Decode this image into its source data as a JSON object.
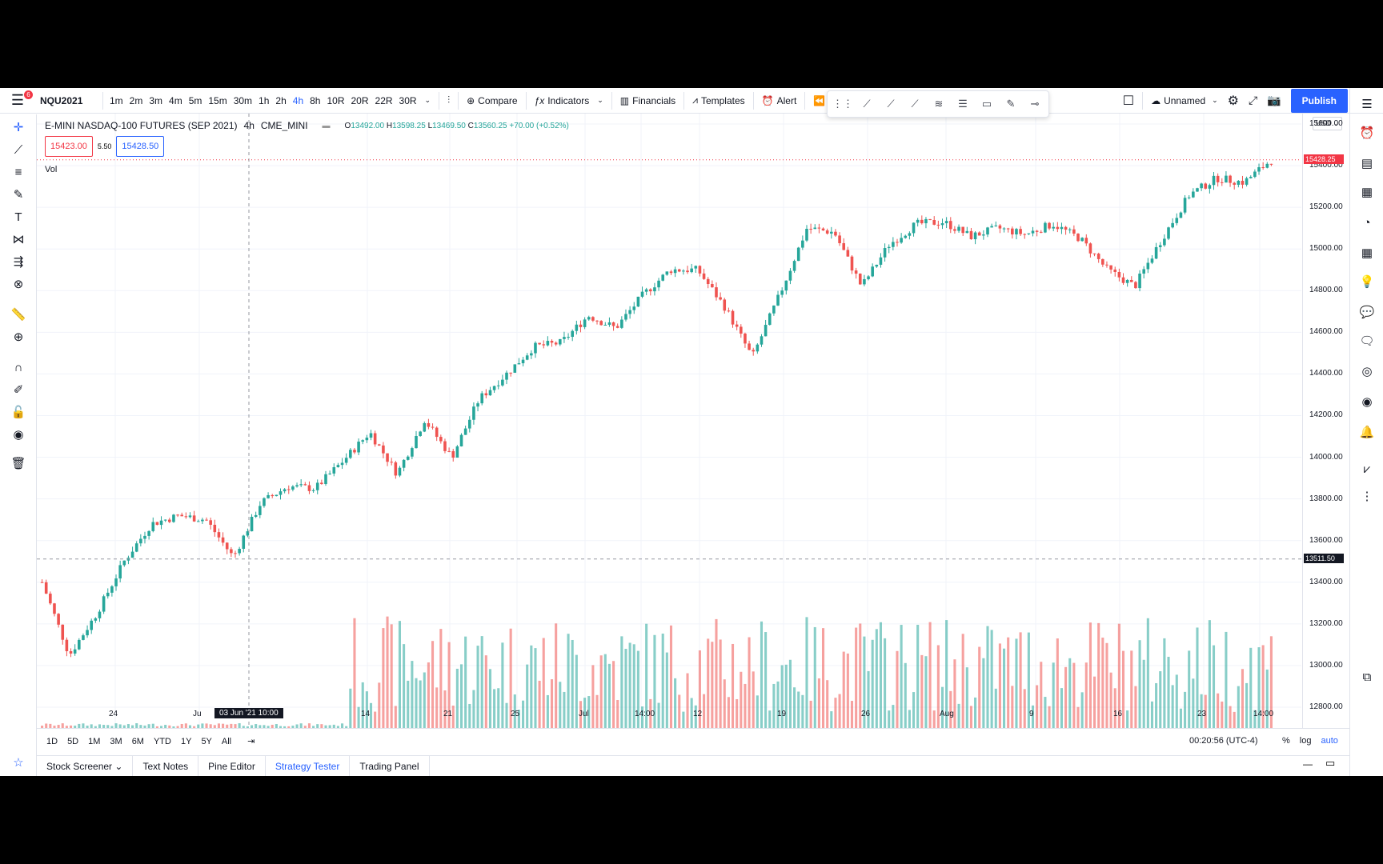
{
  "toolbar": {
    "menu_badge": "6",
    "symbol": "NQU2021",
    "timeframes": [
      "1m",
      "2m",
      "3m",
      "4m",
      "5m",
      "15m",
      "30m",
      "1h",
      "2h",
      "4h",
      "8h",
      "10R",
      "20R",
      "22R",
      "30R"
    ],
    "active_timeframe": "4h",
    "compare": "Compare",
    "indicators": "Indicators",
    "financials": "Financials",
    "templates": "Templates",
    "alert": "Alert",
    "layout_name": "Unnamed",
    "publish": "Publish"
  },
  "legend": {
    "title": "E-MINI NASDAQ-100 FUTURES (SEP 2021)",
    "interval": "4h",
    "exchange": "CME_MINI",
    "open": "13492.00",
    "high": "13598.25",
    "low": "13469.50",
    "close": "13560.25",
    "change": "+70.00 (+0.52%)",
    "bid": "15423.00",
    "spread": "5.50",
    "ask": "15428.50",
    "vol_label": "Vol"
  },
  "price_axis": {
    "currency": "USD",
    "ticks": [
      "15600.00",
      "15400.00",
      "15200.00",
      "15000.00",
      "14800.00",
      "14600.00",
      "14400.00",
      "14200.00",
      "14000.00",
      "13800.00",
      "13600.00",
      "13400.00",
      "13200.00",
      "13000.00",
      "12800.00"
    ],
    "last_price": "15428.25",
    "crosshair_price": "13511.50",
    "last_price_color": "#f23645"
  },
  "time_axis": {
    "labels": [
      "24",
      "Ju",
      "14",
      "21",
      "25",
      "Jul",
      "14:00",
      "12",
      "19",
      "26",
      "Aug",
      "9",
      "16",
      "23",
      "14:00"
    ],
    "crosshair_label": "03 Jun '21   10:00"
  },
  "range_bar": {
    "ranges": [
      "1D",
      "5D",
      "1M",
      "3M",
      "6M",
      "YTD",
      "1Y",
      "5Y",
      "All"
    ],
    "clock": "00:20:56 (UTC-4)",
    "percent": "%",
    "log": "log",
    "auto": "auto"
  },
  "bottom_tabs": [
    "Stock Screener",
    "Text Notes",
    "Pine Editor",
    "Strategy Tester",
    "Trading Panel"
  ],
  "active_bottom_tab": "Strategy Tester",
  "colors": {
    "up": "#26a69a",
    "down": "#ef5350",
    "accent": "#2962ff"
  },
  "chart_data": {
    "type": "candlestick",
    "symbol": "NQU2021",
    "interval": "4h",
    "ylim": [
      12700,
      15650
    ],
    "close_path": [
      [
        "2021-05-19",
        13400
      ],
      [
        "2021-05-20",
        13050
      ],
      [
        "2021-05-21",
        13250
      ],
      [
        "2021-05-24",
        13500
      ],
      [
        "2021-05-26",
        13680
      ],
      [
        "2021-05-28",
        13720
      ],
      [
        "2021-06-01",
        13700
      ],
      [
        "2021-06-03",
        13520
      ],
      [
        "2021-06-04",
        13780
      ],
      [
        "2021-06-07",
        13860
      ],
      [
        "2021-06-08",
        13850
      ],
      [
        "2021-06-10",
        13980
      ],
      [
        "2021-06-14",
        14120
      ],
      [
        "2021-06-16",
        13920
      ],
      [
        "2021-06-18",
        14180
      ],
      [
        "2021-06-21",
        14000
      ],
      [
        "2021-06-22",
        14280
      ],
      [
        "2021-06-25",
        14400
      ],
      [
        "2021-06-29",
        14530
      ],
      [
        "2021-07-01",
        14550
      ],
      [
        "2021-07-06",
        14680
      ],
      [
        "2021-07-08",
        14620
      ],
      [
        "2021-07-09",
        14780
      ],
      [
        "2021-07-12",
        14900
      ],
      [
        "2021-07-14",
        14900
      ],
      [
        "2021-07-16",
        14720
      ],
      [
        "2021-07-19",
        14480
      ],
      [
        "2021-07-21",
        14780
      ],
      [
        "2021-07-23",
        15100
      ],
      [
        "2021-07-26",
        15080
      ],
      [
        "2021-07-27",
        14820
      ],
      [
        "2021-07-29",
        15020
      ],
      [
        "2021-08-02",
        15120
      ],
      [
        "2021-08-04",
        15130
      ],
      [
        "2021-08-06",
        15060
      ],
      [
        "2021-08-09",
        15100
      ],
      [
        "2021-08-11",
        15070
      ],
      [
        "2021-08-13",
        15120
      ],
      [
        "2021-08-16",
        15050
      ],
      [
        "2021-08-18",
        14900
      ],
      [
        "2021-08-19",
        14820
      ],
      [
        "2021-08-20",
        15050
      ],
      [
        "2021-08-23",
        15260
      ],
      [
        "2021-08-24",
        15340
      ],
      [
        "2021-08-26",
        15320
      ],
      [
        "2021-08-27",
        15428
      ]
    ],
    "last_close": 15428.25
  }
}
